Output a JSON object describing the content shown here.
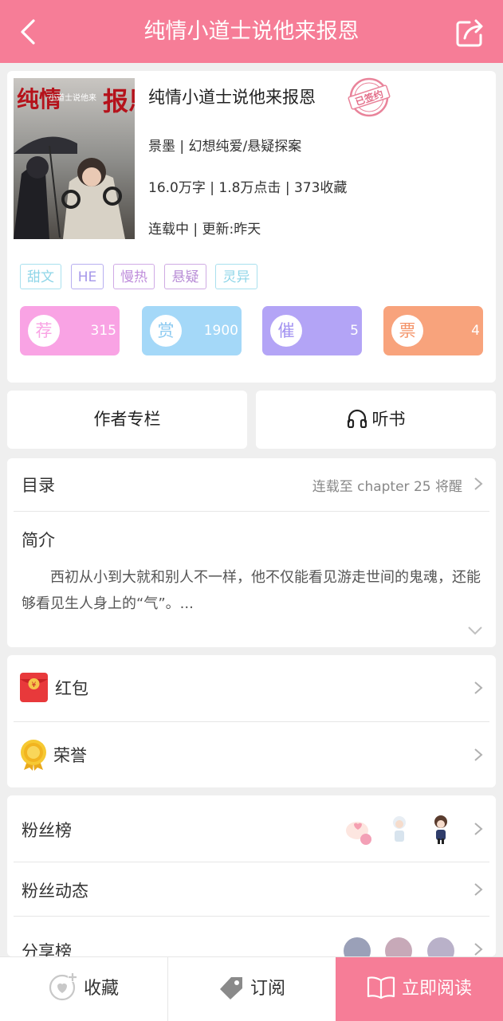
{
  "header": {
    "title": "纯情小道士说他来报恩"
  },
  "book": {
    "title": "纯情小道士说他来报恩",
    "stamp": "已签约",
    "author_genre": "景墨 | 幻想纯爱/悬疑探案",
    "stats_line": "16.0万字 | 1.8万点击 | 373收藏",
    "status_line": "连载中 | 更新:昨天",
    "cover_text": {
      "line1": "纯情",
      "small": "小道士说他来",
      "line2": "报恩"
    },
    "tags": [
      "甜文",
      "HE",
      "慢热",
      "悬疑",
      "灵异"
    ],
    "actions": [
      {
        "glyph": "荐",
        "count": "315",
        "color": "#f9a3e4"
      },
      {
        "glyph": "赏",
        "count": "1900",
        "color": "#a4d8f8"
      },
      {
        "glyph": "催",
        "count": "5",
        "color": "#b3a4f6"
      },
      {
        "glyph": "票",
        "count": "4",
        "color": "#f8a37c"
      }
    ]
  },
  "buttons": {
    "author": "作者专栏",
    "listen": "听书"
  },
  "toc": {
    "label": "目录",
    "latest": "连载至 chapter 25 将醒"
  },
  "intro": {
    "label": "简介",
    "text": "西初从小到大就和别人不一样，他不仅能看见游走世间的鬼魂，还能够看见生人身上的“气”。..."
  },
  "perks": {
    "redpacket": "红包",
    "honor": "荣誉"
  },
  "fans": {
    "rank": "粉丝榜",
    "feed": "粉丝动态",
    "share": "分享榜"
  },
  "bottom": {
    "collect": "收藏",
    "subscribe": "订阅",
    "read": "立即阅读"
  }
}
